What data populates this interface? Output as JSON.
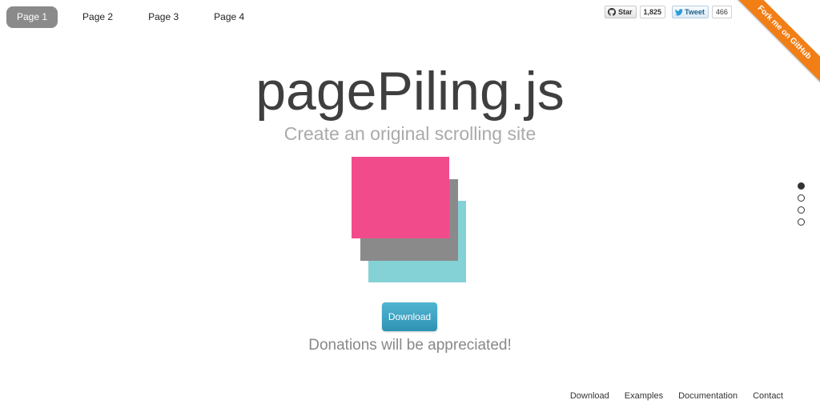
{
  "nav": {
    "items": [
      {
        "label": "Page 1",
        "active": true
      },
      {
        "label": "Page 2",
        "active": false
      },
      {
        "label": "Page 3",
        "active": false
      },
      {
        "label": "Page 4",
        "active": false
      }
    ]
  },
  "social": {
    "star_label": "Star",
    "star_count": "1,825",
    "tweet_label": "Tweet",
    "tweet_count": "466"
  },
  "ribbon": {
    "label": "Fork me on GitHub",
    "color": "#f27e16"
  },
  "hero": {
    "title": "pagePiling.js",
    "subtitle": "Create an original scrolling site"
  },
  "logo": {
    "colors": [
      "#f24b8c",
      "#8a8a8a",
      "#84d2d6"
    ]
  },
  "download": {
    "label": "Download",
    "color": "#3fa4c4"
  },
  "donations": "Donations will be appreciated!",
  "pagination": {
    "total": 4,
    "active_index": 0
  },
  "footer": {
    "links": [
      "Download",
      "Examples",
      "Documentation",
      "Contact"
    ]
  }
}
